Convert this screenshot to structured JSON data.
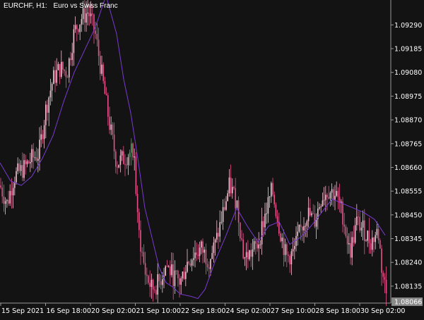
{
  "window": {
    "symbol": "EURCHF, H1:",
    "description": "Euro vs Swiss Franc"
  },
  "colors": {
    "background": "#131313",
    "axis": "#9a9a9a",
    "text": "#ffffff",
    "bear_candle": "#e8508a",
    "bull_candle": "#f2c4d2",
    "green_candle": "#3cb44a",
    "moving_average": "#7a3ad1",
    "current_price_box": "#8a8a8a"
  },
  "chart_data": {
    "type": "line",
    "subtype": "candlestick-with-moving-average",
    "ylim": [
      1.0806,
      1.094
    ],
    "y_ticks": [
      "1.09395",
      "1.09290",
      "1.09185",
      "1.09080",
      "1.08975",
      "1.08870",
      "1.08765",
      "1.08660",
      "1.08555",
      "1.08450",
      "1.08345",
      "1.08240",
      "1.08135"
    ],
    "current_price": "1.08066",
    "x_ticks": [
      "15 Sep 2021",
      "16 Sep 18:00",
      "20 Sep 02:00",
      "21 Sep 10:00",
      "22 Sep 18:00",
      "24 Sep 02:00",
      "27 Sep 10:00",
      "28 Sep 18:00",
      "30 Sep 02:00"
    ],
    "price_path": [
      [
        0,
        1.0858
      ],
      [
        10,
        1.085
      ],
      [
        20,
        1.0862
      ],
      [
        35,
        1.0866
      ],
      [
        45,
        1.087
      ],
      [
        55,
        1.0872
      ],
      [
        65,
        1.0892
      ],
      [
        75,
        1.0905
      ],
      [
        85,
        1.091
      ],
      [
        95,
        1.0908
      ],
      [
        105,
        1.0926
      ],
      [
        115,
        1.0932
      ],
      [
        125,
        1.0935
      ],
      [
        135,
        1.0925
      ],
      [
        145,
        1.0905
      ],
      [
        155,
        1.0885
      ],
      [
        165,
        1.0868
      ],
      [
        175,
        1.087
      ],
      [
        185,
        1.0873
      ],
      [
        190,
        1.087
      ],
      [
        195,
        1.084
      ],
      [
        205,
        1.082
      ],
      [
        215,
        1.0812
      ],
      [
        225,
        1.0815
      ],
      [
        235,
        1.0823
      ],
      [
        245,
        1.0818
      ],
      [
        255,
        1.0815
      ],
      [
        265,
        1.0824
      ],
      [
        275,
        1.0828
      ],
      [
        285,
        1.083
      ],
      [
        295,
        1.0825
      ],
      [
        305,
        1.0832
      ],
      [
        315,
        1.0845
      ],
      [
        325,
        1.0858
      ],
      [
        335,
        1.0851
      ],
      [
        345,
        1.0826
      ],
      [
        355,
        1.0828
      ],
      [
        365,
        1.0832
      ],
      [
        375,
        1.0845
      ],
      [
        385,
        1.0856
      ],
      [
        395,
        1.084
      ],
      [
        405,
        1.0826
      ],
      [
        415,
        1.0828
      ],
      [
        425,
        1.0838
      ],
      [
        435,
        1.0846
      ],
      [
        445,
        1.0842
      ],
      [
        455,
        1.0853
      ],
      [
        465,
        1.0856
      ],
      [
        475,
        1.0854
      ],
      [
        485,
        1.0845
      ],
      [
        495,
        1.0828
      ],
      [
        505,
        1.0842
      ],
      [
        515,
        1.0838
      ],
      [
        525,
        1.0833
      ],
      [
        535,
        1.0838
      ],
      [
        540,
        1.0822
      ],
      [
        548,
        1.0808
      ]
    ],
    "moving_average": [
      [
        0,
        1.0868
      ],
      [
        15,
        1.086
      ],
      [
        30,
        1.0858
      ],
      [
        45,
        1.0862
      ],
      [
        60,
        1.087
      ],
      [
        75,
        1.088
      ],
      [
        90,
        1.0895
      ],
      [
        105,
        1.0908
      ],
      [
        120,
        1.0918
      ],
      [
        135,
        1.0928
      ],
      [
        150,
        1.0942
      ],
      [
        165,
        1.0925
      ],
      [
        175,
        1.0905
      ],
      [
        185,
        1.089
      ],
      [
        195,
        1.087
      ],
      [
        205,
        1.0848
      ],
      [
        215,
        1.0835
      ],
      [
        225,
        1.0822
      ],
      [
        235,
        1.0815
      ],
      [
        245,
        1.0813
      ],
      [
        255,
        1.081
      ],
      [
        270,
        1.0809
      ],
      [
        280,
        1.0808
      ],
      [
        290,
        1.0812
      ],
      [
        305,
        1.0825
      ],
      [
        320,
        1.0836
      ],
      [
        335,
        1.0848
      ],
      [
        350,
        1.084
      ],
      [
        365,
        1.0833
      ],
      [
        380,
        1.084
      ],
      [
        395,
        1.0842
      ],
      [
        410,
        1.0832
      ],
      [
        425,
        1.0835
      ],
      [
        440,
        1.084
      ],
      [
        455,
        1.0846
      ],
      [
        470,
        1.0852
      ],
      [
        485,
        1.085
      ],
      [
        500,
        1.0848
      ],
      [
        515,
        1.0846
      ],
      [
        530,
        1.0843
      ],
      [
        545,
        1.0836
      ]
    ]
  }
}
